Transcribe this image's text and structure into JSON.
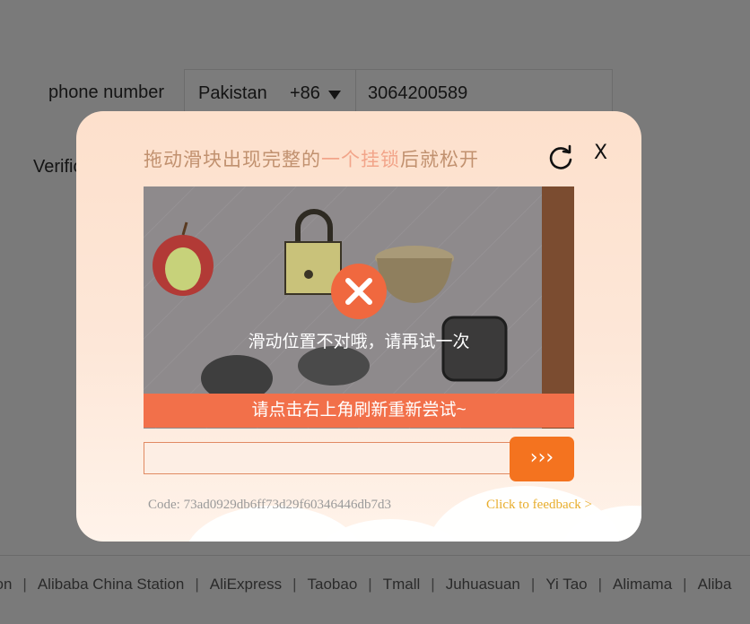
{
  "form": {
    "phone_label": "phone number",
    "verification_label": "Verific",
    "country": "Pakistan",
    "country_code": "+86",
    "phone_value": "3064200589"
  },
  "captcha": {
    "title_before": "拖动滑块出现完整的",
    "title_highlight": "一个挂锁",
    "title_after": "后就松开",
    "close_label": "X",
    "error_message": "滑动位置不对哦，请再试一次",
    "tip_message": "请点击右上角刷新重新尝试~",
    "slider_handle_label": "›››",
    "code_text": "Code: 73ad0929db6ff73d29f60346446db7d3",
    "feedback_link": "Click to feedback >",
    "icons": {
      "refresh": "refresh-icon",
      "error": "x-circle-icon",
      "close": "close-icon"
    },
    "colors": {
      "accent": "#f4731f",
      "tip_bar": "#f2704a",
      "feedback": "#e8ad2c"
    }
  },
  "footer": {
    "links": [
      "tion",
      "Alibaba China Station",
      "AliExpress",
      "Taobao",
      "Tmall",
      "Juhuasuan",
      "Yi Tao",
      "Alimama",
      "Aliba"
    ]
  }
}
